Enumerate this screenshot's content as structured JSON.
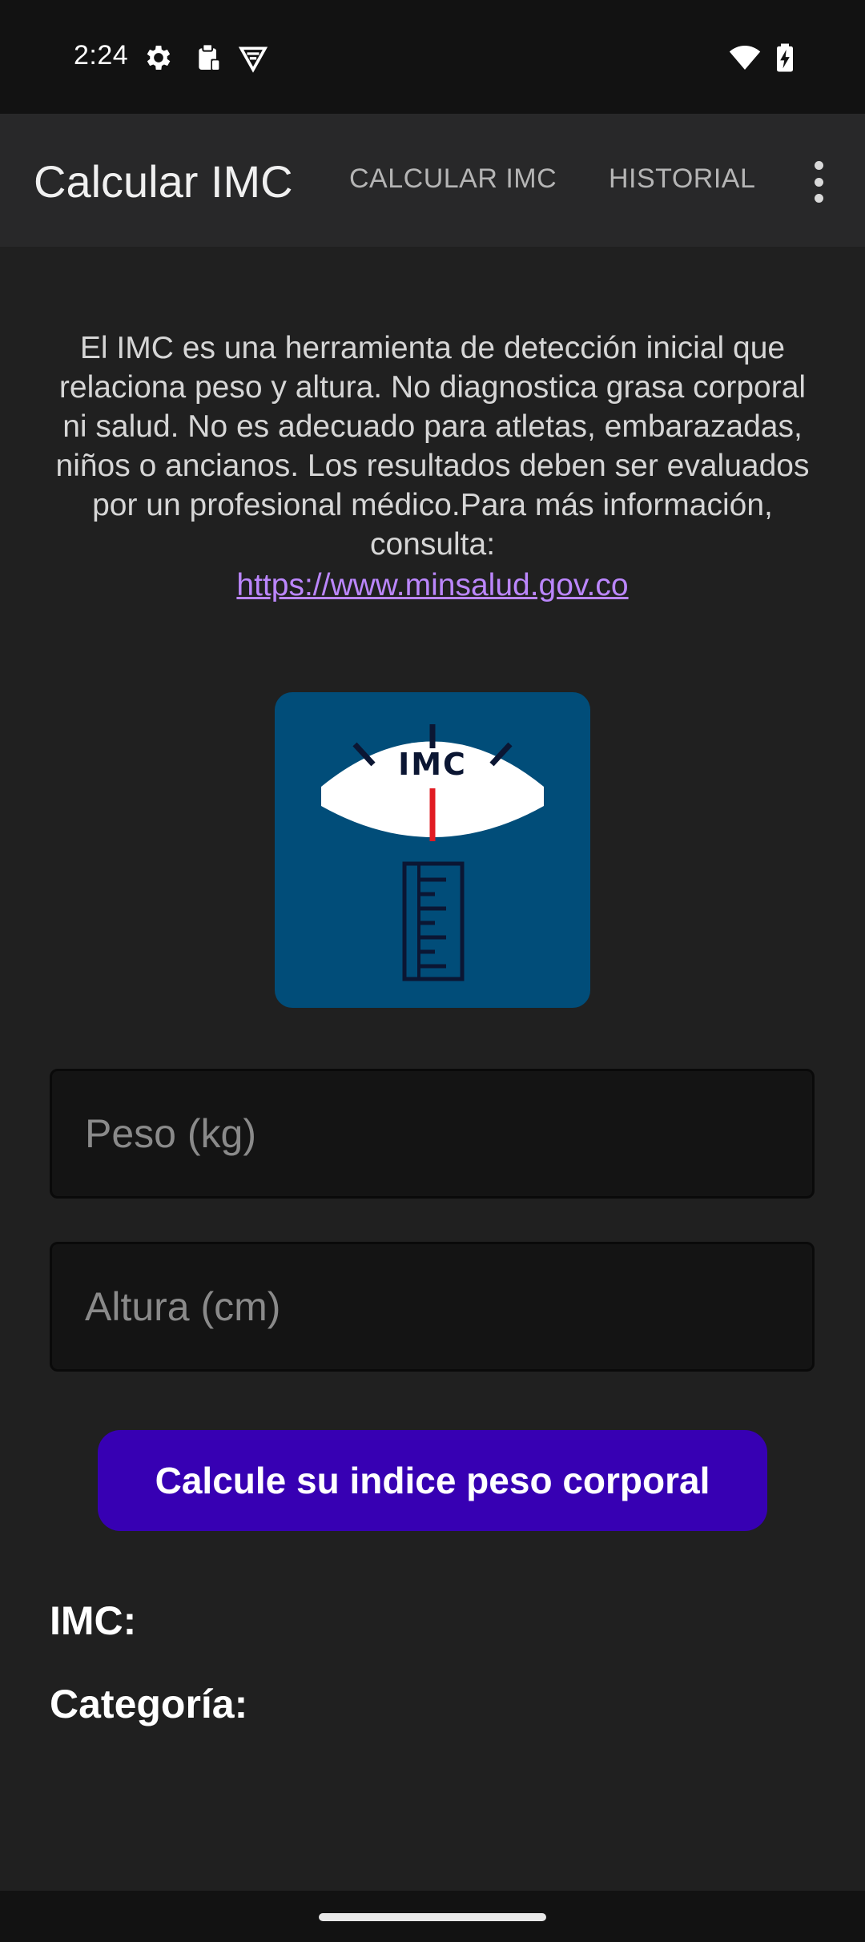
{
  "status_bar": {
    "time": "2:24",
    "icons_left": [
      "gear-icon",
      "clipboard-icon",
      "vpn-shield-icon"
    ],
    "icons_right": [
      "wifi-icon",
      "battery-charging-icon"
    ]
  },
  "app_bar": {
    "title": "Calcular IMC",
    "tabs": [
      {
        "label": "CALCULAR IMC"
      },
      {
        "label": "HISTORIAL"
      }
    ],
    "overflow_icon": "more-vert-icon"
  },
  "info": {
    "text": "El IMC es una herramienta de detección inicial que relaciona peso y altura. No diagnostica grasa corporal ni salud. No es adecuado para atletas, embarazadas, niños o ancianos. Los resultados deben ser evaluados por un profesional médico.Para más información, consulta:",
    "link": "https://www.minsalud.gov.co"
  },
  "logo": {
    "label": "IMC",
    "colors": {
      "background": "#014d79",
      "dial": "#ffffff",
      "needle": "#e11b22",
      "ink": "#0b1633"
    }
  },
  "form": {
    "weight_placeholder": "Peso (kg)",
    "height_placeholder": "Altura (cm)",
    "submit_label": "Calcule su indice peso corporal"
  },
  "results": {
    "imc_label": "IMC:",
    "category_label": "Categoría:"
  },
  "colors": {
    "background": "#202020",
    "app_bar": "#282829",
    "accent_button": "#3700b3",
    "link": "#bb86fc"
  }
}
